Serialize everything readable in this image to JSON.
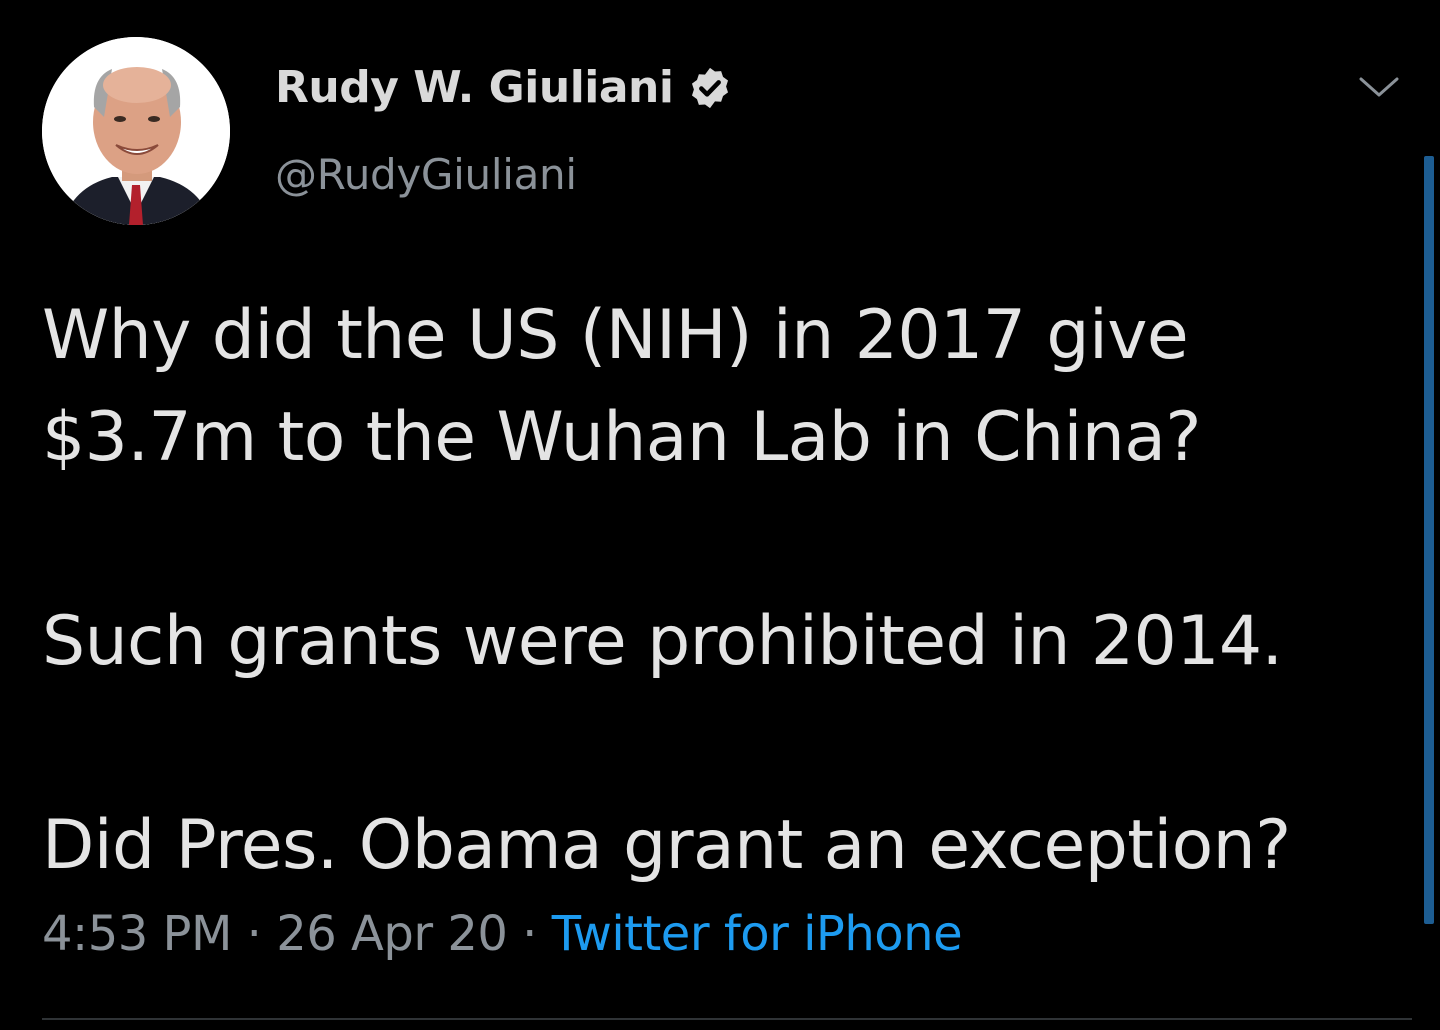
{
  "author": {
    "display_name": "Rudy W. Giuliani",
    "handle": "@RudyGiuliani",
    "verified": true,
    "verified_icon": "verified-badge-icon"
  },
  "tweet": {
    "paragraphs": [
      "Why did the US (NIH) in 2017 give",
      "$3.7m to the Wuhan Lab in China?",
      "Such grants were prohibited in 2014.",
      "Did Pres. Obama grant an exception?"
    ]
  },
  "meta": {
    "time": "4:53 PM",
    "separator": " · ",
    "date": "26 Apr 20",
    "source": "Twitter for iPhone"
  },
  "colors": {
    "background": "#000000",
    "text": "#e4e4e4",
    "secondary": "#8b9299",
    "link": "#1d9bf0",
    "scrollbar": "#1d5d92"
  }
}
